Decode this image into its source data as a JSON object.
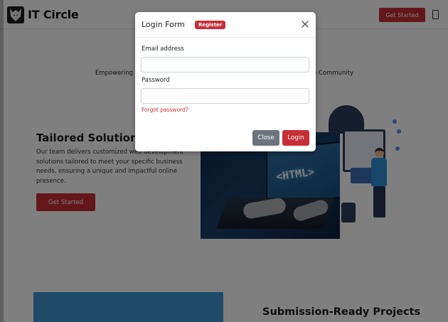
{
  "navbar": {
    "brand": "IT Circle",
    "cta_label": "Get Started",
    "logo_icon": "wolf-logo-icon",
    "toggle_icon": "menu-toggle-icon"
  },
  "hero": {
    "tagline_start": "Empowering",
    "tagline_end": "e Community",
    "section_title": "Tailored Solutions",
    "section_body": "Our team delivers customized web development solutions tailored to meet your specific business needs, ensuring a unique and impactful online presence.",
    "cta_label": "Get Started",
    "illustration_text": "<HTML>"
  },
  "projects": {
    "title": "Submission-Ready Projects"
  },
  "modal": {
    "title": "Login Form",
    "badge": "Register",
    "close_icon": "close-icon",
    "email_label": "Email address",
    "email_value": "",
    "password_label": "Password",
    "password_value": "",
    "forgot_link": "Forgot password?",
    "close_button": "Close",
    "login_button": "Login"
  },
  "colors": {
    "accent": "#c62f36",
    "secondary_button": "#6c757d",
    "panel_blue": "#3f96d1"
  }
}
